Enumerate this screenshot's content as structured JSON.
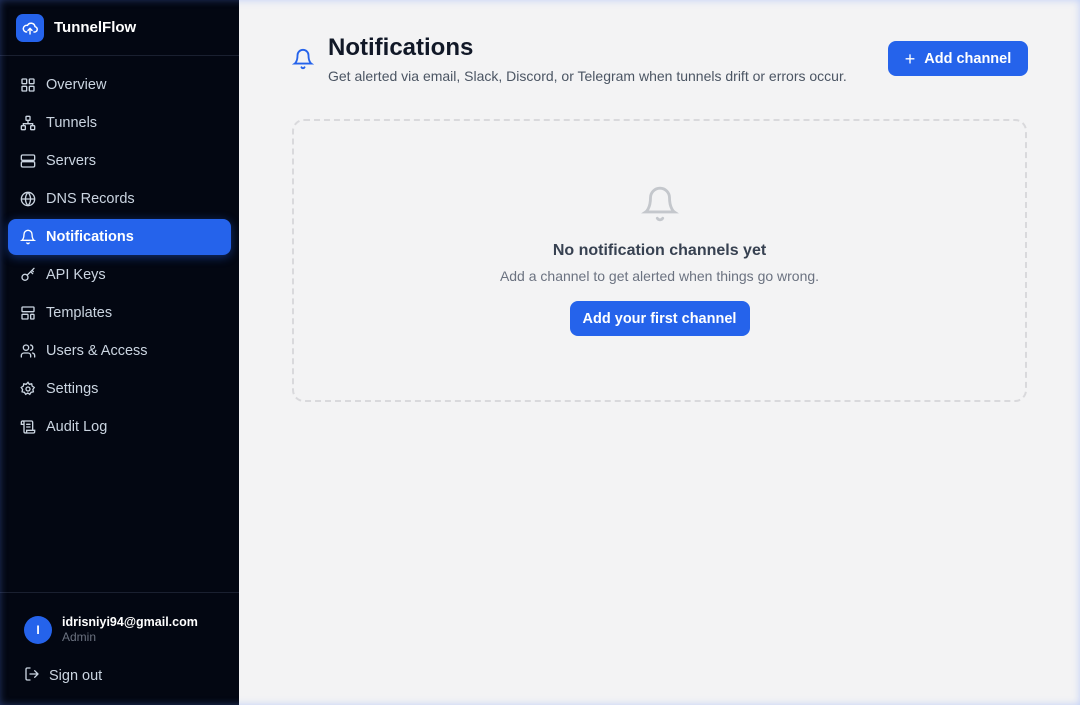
{
  "brand": {
    "name": "TunnelFlow",
    "logo_icon": "cloud-upload-icon"
  },
  "sidebar": {
    "items": [
      {
        "label": "Overview",
        "icon": "grid-icon",
        "active": false
      },
      {
        "label": "Tunnels",
        "icon": "network-icon",
        "active": false
      },
      {
        "label": "Servers",
        "icon": "server-icon",
        "active": false
      },
      {
        "label": "DNS Records",
        "icon": "globe-icon",
        "active": false
      },
      {
        "label": "Notifications",
        "icon": "bell-icon",
        "active": true
      },
      {
        "label": "API Keys",
        "icon": "key-icon",
        "active": false
      },
      {
        "label": "Templates",
        "icon": "layout-icon",
        "active": false
      },
      {
        "label": "Users & Access",
        "icon": "users-icon",
        "active": false
      },
      {
        "label": "Settings",
        "icon": "gear-icon",
        "active": false
      },
      {
        "label": "Audit Log",
        "icon": "scroll-icon",
        "active": false
      }
    ]
  },
  "user": {
    "initial": "I",
    "email": "idrisniyi94@gmail.com",
    "role": "Admin"
  },
  "signout": {
    "label": "Sign out"
  },
  "header": {
    "title": "Notifications",
    "subtitle": "Get alerted via email, Slack, Discord, or Telegram when tunnels drift or errors occur.",
    "add_button": "Add channel"
  },
  "empty_state": {
    "title": "No notification channels yet",
    "description": "Add a channel to get alerted when things go wrong.",
    "button": "Add your first channel"
  },
  "colors": {
    "accent": "#2563eb",
    "sidebar_bg": "#030712",
    "main_bg": "#f3f3f4"
  }
}
